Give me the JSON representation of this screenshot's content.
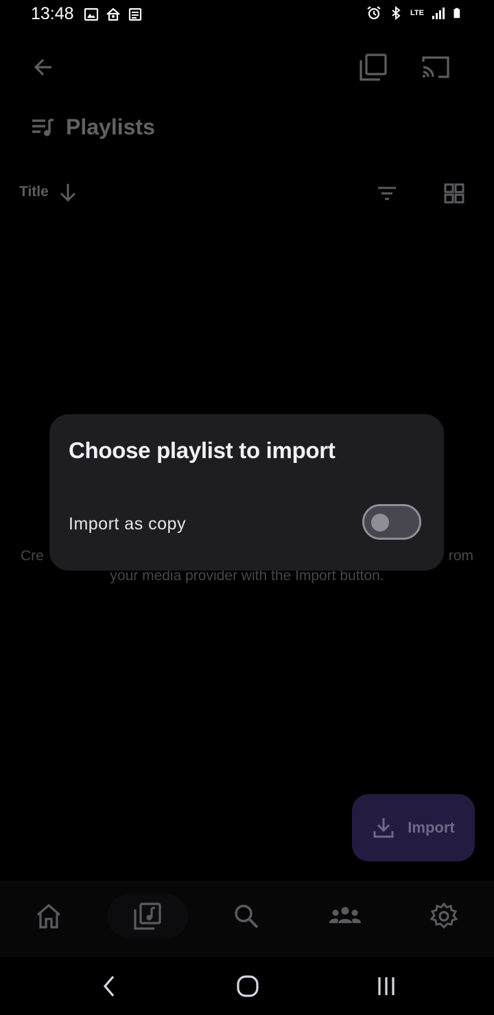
{
  "status_bar": {
    "time": "13:48",
    "left_icons": [
      "image-icon",
      "home-sensor-icon",
      "news-icon"
    ],
    "right_icons": [
      "alarm-icon",
      "bluetooth-icon",
      "lte-icon",
      "signal-icon",
      "battery-icon"
    ],
    "network": "LTE"
  },
  "app_bar": {
    "back_icon": "arrow-back-icon",
    "actions": [
      "copy-icon",
      "cast-icon"
    ]
  },
  "section": {
    "icon": "playlist-icon",
    "title": "Playlists"
  },
  "sort": {
    "label": "Title",
    "direction_icon": "arrow-down-icon",
    "filter_icon": "filter-icon",
    "view_icon": "grid-view-icon"
  },
  "empty_state": {
    "line1_visible_left": "Cre",
    "line1_visible_right": "rom",
    "line2": "your media provider with the Import button."
  },
  "dialog": {
    "title": "Choose playlist to import",
    "option_label": "Import as copy",
    "option_value": false
  },
  "fab": {
    "icon": "download-icon",
    "label": "Import"
  },
  "bottom_nav": {
    "items": [
      {
        "name": "home",
        "icon": "home-icon"
      },
      {
        "name": "library",
        "icon": "music-library-icon",
        "selected": true
      },
      {
        "name": "search",
        "icon": "search-icon"
      },
      {
        "name": "people",
        "icon": "people-icon"
      },
      {
        "name": "settings",
        "icon": "gear-icon"
      }
    ]
  },
  "colors": {
    "background": "#000000",
    "dialog": "#1e1e21",
    "fab": "#241c40",
    "nav_bar": "#121214"
  }
}
